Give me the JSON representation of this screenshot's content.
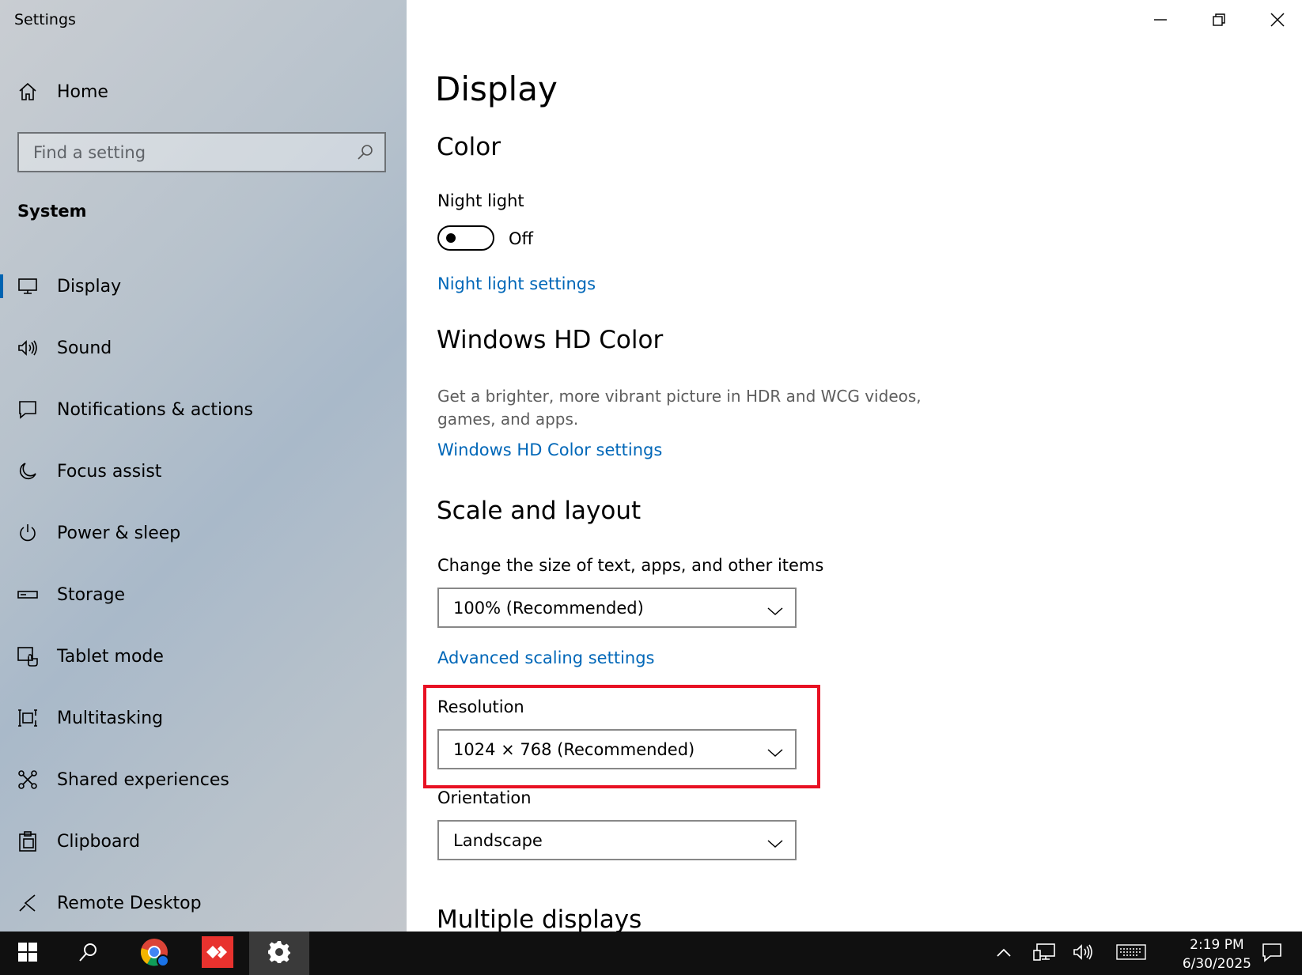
{
  "window": {
    "title": "Settings"
  },
  "sidebar": {
    "home_label": "Home",
    "search_placeholder": "Find a setting",
    "section_label": "System",
    "items": [
      {
        "label": "Display",
        "icon": "monitor-icon",
        "active": true
      },
      {
        "label": "Sound",
        "icon": "speaker-icon"
      },
      {
        "label": "Notifications & actions",
        "icon": "message-icon"
      },
      {
        "label": "Focus assist",
        "icon": "moon-icon"
      },
      {
        "label": "Power & sleep",
        "icon": "power-icon"
      },
      {
        "label": "Storage",
        "icon": "storage-icon"
      },
      {
        "label": "Tablet mode",
        "icon": "tablet-icon"
      },
      {
        "label": "Multitasking",
        "icon": "multitasking-icon"
      },
      {
        "label": "Shared experiences",
        "icon": "shared-icon"
      },
      {
        "label": "Clipboard",
        "icon": "clipboard-icon"
      },
      {
        "label": "Remote Desktop",
        "icon": "remote-desktop-icon"
      }
    ]
  },
  "main": {
    "page_title": "Display",
    "color": {
      "heading": "Color",
      "night_light_label": "Night light",
      "night_light_state": "Off",
      "night_light_link": "Night light settings"
    },
    "hd_color": {
      "heading": "Windows HD Color",
      "description": "Get a brighter, more vibrant picture in HDR and WCG videos, games, and apps.",
      "link": "Windows HD Color settings"
    },
    "scale_layout": {
      "heading": "Scale and layout",
      "scale_label": "Change the size of text, apps, and other items",
      "scale_value": "100% (Recommended)",
      "advanced_link": "Advanced scaling settings",
      "resolution_label": "Resolution",
      "resolution_value": "1024 × 768 (Recommended)",
      "orientation_label": "Orientation",
      "orientation_value": "Landscape"
    },
    "multiple_displays": {
      "heading": "Multiple displays"
    }
  },
  "taskbar": {
    "time": "2:19 PM",
    "date": "6/30/2025"
  },
  "colors": {
    "accent": "#0067b8",
    "highlight": "#e81123",
    "taskbar": "#101010"
  }
}
